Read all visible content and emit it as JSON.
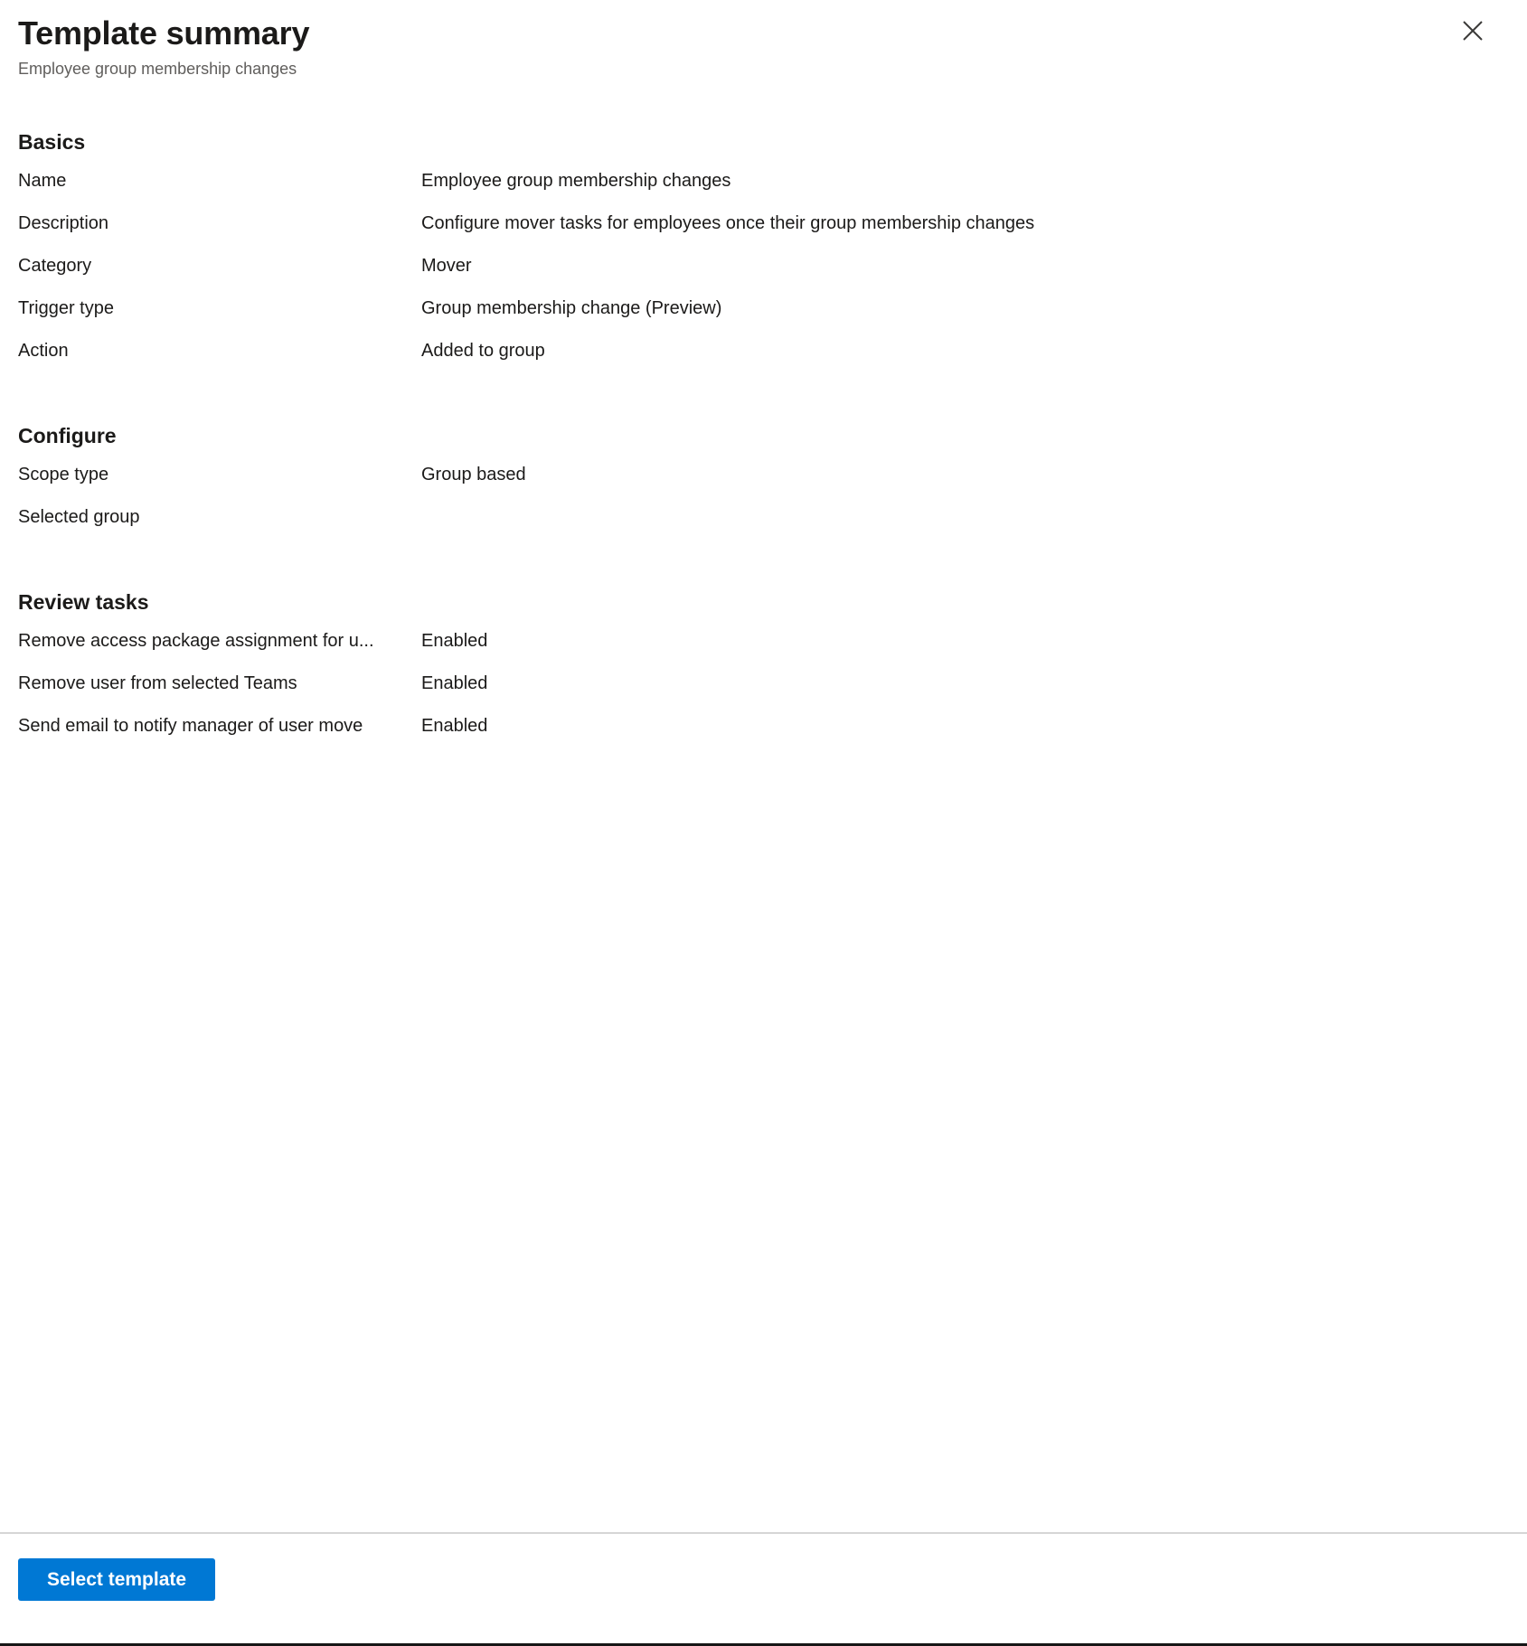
{
  "header": {
    "title": "Template summary",
    "subtitle": "Employee group membership changes",
    "close_icon": "close-icon"
  },
  "sections": [
    {
      "heading": "Basics",
      "rows": [
        {
          "label": "Name",
          "value": "Employee group membership changes"
        },
        {
          "label": "Description",
          "value": "Configure mover tasks for employees once their group membership changes"
        },
        {
          "label": "Category",
          "value": "Mover"
        },
        {
          "label": "Trigger type",
          "value": "Group membership change (Preview)"
        },
        {
          "label": "Action",
          "value": "Added to group"
        }
      ]
    },
    {
      "heading": "Configure",
      "rows": [
        {
          "label": "Scope type",
          "value": "Group based"
        },
        {
          "label": "Selected group",
          "value": ""
        }
      ]
    },
    {
      "heading": "Review tasks",
      "rows": [
        {
          "label": "Remove access package assignment for u...",
          "value": "Enabled"
        },
        {
          "label": "Remove user from selected Teams",
          "value": "Enabled"
        },
        {
          "label": "Send email to notify manager of user move",
          "value": "Enabled"
        }
      ]
    }
  ],
  "footer": {
    "primary_button": "Select template"
  },
  "colors": {
    "accent": "#0078d4",
    "text": "#1b1a19",
    "secondary_text": "#605e5c",
    "divider": "#d6d6d6"
  }
}
